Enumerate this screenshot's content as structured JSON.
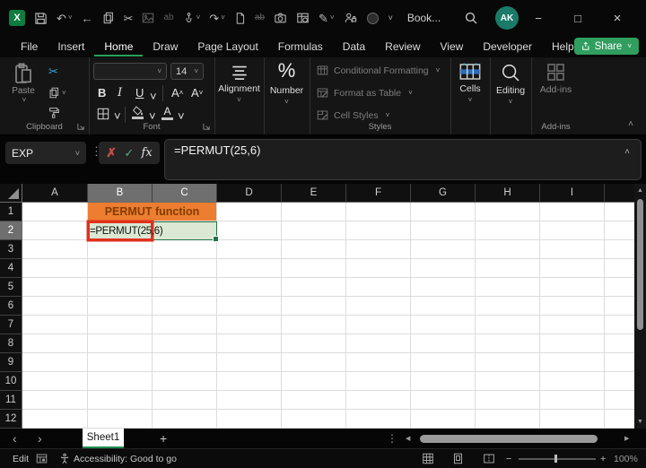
{
  "icons": {
    "chevron_down": "˅",
    "chevron_up": "˄",
    "back_arrow": "←",
    "undo": "↶",
    "redo": "↷",
    "scissors": "✂",
    "pencil": "✎",
    "dots_vertical": "⋮",
    "check": "✓",
    "cancel": "✗",
    "close": "×",
    "minimize": "−",
    "maximize": "□",
    "plus": "+",
    "nav_left": "‹",
    "nav_right": "›",
    "scroll_up": "▲",
    "scroll_down": "▼",
    "scroll_left": "◀",
    "scroll_right": "▶",
    "percent_glyph": "%",
    "minus": "−",
    "ab_plain": "ab",
    "ab_strike": "ab"
  },
  "titlebar": {
    "document_title": "Book...",
    "avatar_initials": "AK"
  },
  "menubar": {
    "tabs": [
      "File",
      "Insert",
      "Home",
      "Draw",
      "Page Layout",
      "Formulas",
      "Data",
      "Review",
      "View",
      "Developer",
      "Help"
    ],
    "active_tab": "Home",
    "share_label": "Share"
  },
  "ribbon": {
    "paste_label": "Paste",
    "clipboard_group_label": "Clipboard",
    "font_size_value": "14",
    "bold_label": "B",
    "italic_label": "I",
    "underline_label": "U",
    "grow_font_label": "A",
    "shrink_font_label": "A",
    "font_color_label": "A",
    "font_group_label": "Font",
    "alignment_label": "Alignment",
    "number_label": "Number",
    "styles_items": [
      "Conditional Formatting",
      "Format as Table",
      "Cell Styles"
    ],
    "styles_group_label": "Styles",
    "cells_label": "Cells",
    "editing_label": "Editing",
    "addins_button_label": "Add-ins",
    "addins_group_label": "Add-ins"
  },
  "formula_bar": {
    "name_box_value": "EXP",
    "fx_label": "fx",
    "formula_text": "=PERMUT(25,6)"
  },
  "grid": {
    "columns": [
      "A",
      "B",
      "C",
      "D",
      "E",
      "F",
      "G",
      "H",
      "I"
    ],
    "rows": [
      "1",
      "2",
      "3",
      "4",
      "5",
      "6",
      "7",
      "8",
      "9",
      "10",
      "11",
      "12"
    ],
    "selected_columns": "B:C",
    "selected_row": "2",
    "merged_title_cell": {
      "text": "PERMUT function"
    },
    "formula_cell": {
      "text": "=PERMUT(25,6)"
    }
  },
  "sheet_bar": {
    "sheet_tab": "Sheet1"
  },
  "status_bar": {
    "mode": "Edit",
    "accessibility_text": "Accessibility: Good to go",
    "zoom_value": "100%"
  },
  "colors": {
    "share_green": "#2f9e5f",
    "excel_green": "#107C41",
    "tab_underline_green": "#27a05c",
    "title_cell_fill": "#ED7D31",
    "title_cell_text": "#833C00",
    "result_cell_fill": "#DBE8D3",
    "highlight_border_red": "#E0301E",
    "selection_green": "#217346",
    "avatar_teal": "#1b7a68"
  }
}
